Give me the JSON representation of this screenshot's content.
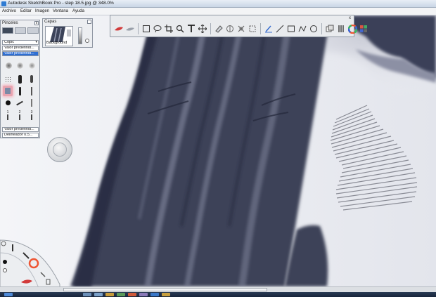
{
  "window": {
    "title": "Autodesk SketchBook Pro - step 18.5.jpg @ 348.0%"
  },
  "menu": {
    "items": [
      "Archivo",
      "Editar",
      "Imagen",
      "Ventana",
      "Ayuda"
    ]
  },
  "brush_palette": {
    "title": "Pinceles",
    "close_glyph": "x",
    "set_name": "Copic",
    "preset_1": "Valor predefinid...",
    "preset_2": "Valor predefinid...",
    "preset_3": "Valor predefinid...",
    "preset_4": "Delineador 0.5...",
    "brush_size_labels": [
      "1",
      "2",
      "3"
    ]
  },
  "layers_palette": {
    "title": "Capas",
    "layer_name": "Background"
  },
  "toolbar": {
    "close_glyph": "x",
    "tools": [
      "brush-color-icon",
      "smudge-icon",
      "rect-select-icon",
      "lasso-icon",
      "crop-icon",
      "zoom-icon",
      "text-icon",
      "move-icon",
      "eraser-icon",
      "symmetry-icon",
      "distort-icon",
      "transform-icon",
      "pen-icon",
      "line-icon",
      "rectangle-icon",
      "polyline-icon",
      "ellipse-icon",
      "layers-toggle-icon",
      "brush-palette-icon",
      "color-wheel-icon",
      "copic-icon"
    ]
  },
  "colors": {
    "ink": "#3c4359",
    "ink_dark": "#2a2f44",
    "paper": "#f2f3f6",
    "accent": "#d23b3b",
    "select_blue": "#2f6fd3"
  }
}
